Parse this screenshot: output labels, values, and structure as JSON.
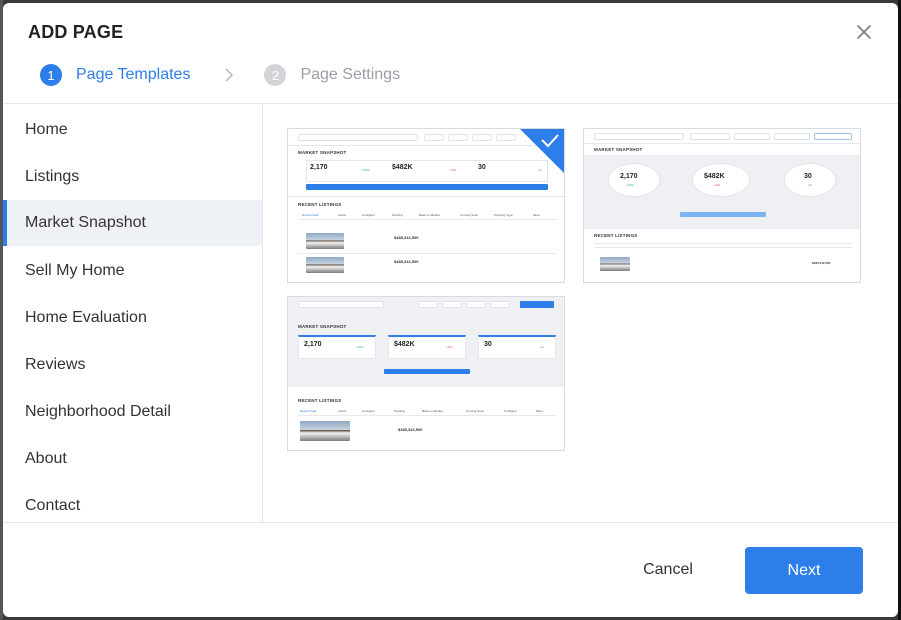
{
  "dialog": {
    "title": "ADD PAGE",
    "steps": [
      {
        "number": "1",
        "label": "Page Templates",
        "state": "active"
      },
      {
        "number": "2",
        "label": "Page Settings",
        "state": "inactive"
      }
    ]
  },
  "sidebar": {
    "items": [
      {
        "label": "Home",
        "selected": false
      },
      {
        "label": "Listings",
        "selected": false
      },
      {
        "label": "Market Snapshot",
        "selected": true
      },
      {
        "label": "Sell My Home",
        "selected": false
      },
      {
        "label": "Home Evaluation",
        "selected": false
      },
      {
        "label": "Reviews",
        "selected": false
      },
      {
        "label": "Neighborhood Detail",
        "selected": false
      },
      {
        "label": "About",
        "selected": false
      },
      {
        "label": "Contact",
        "selected": false
      }
    ]
  },
  "templates": [
    {
      "selected": true,
      "section_title": "MARKET SNAPSHOT",
      "stats": [
        {
          "value": "2,170",
          "change": "+33%",
          "trend": "up"
        },
        {
          "value": "$482K",
          "change": "+4%",
          "trend": "down"
        },
        {
          "value": "30",
          "change": "+3",
          "trend": "down"
        }
      ],
      "listings_title": "RECENT LISTINGS",
      "tabs": [
        "Recent Sold",
        "Active",
        "Contigent",
        "Pending",
        "Back on Market",
        "Coming Soon",
        "Property Type",
        "More"
      ],
      "listings": [
        {
          "price": "$485,342,500"
        },
        {
          "price": "$485,342,500"
        }
      ]
    },
    {
      "selected": false,
      "section_title": "MARKET SNAPSHOT",
      "stats": [
        {
          "value": "2,170",
          "change": "+33%",
          "trend": "up"
        },
        {
          "value": "$482K",
          "change": "+4%",
          "trend": "down"
        },
        {
          "value": "30",
          "change": "+3",
          "trend": "down"
        }
      ],
      "listings_title": "RECENT LISTINGS",
      "listings": [
        {
          "price": "$485,342,500"
        }
      ]
    },
    {
      "selected": false,
      "section_title": "MARKET SNAPSHOT",
      "stats": [
        {
          "value": "2,170",
          "change": "+33%",
          "trend": "up"
        },
        {
          "value": "$482K",
          "change": "+4%",
          "trend": "down"
        },
        {
          "value": "30",
          "change": "+3",
          "trend": "down"
        }
      ],
      "listings_title": "RECENT LISTINGS",
      "tabs": [
        "Recent Sold",
        "Active",
        "Contigent",
        "Pending",
        "Back on Market",
        "Coming Soon",
        "Contigent",
        "More"
      ],
      "listings": [
        {
          "price": "$485,342,500"
        }
      ]
    }
  ],
  "footer": {
    "cancel_label": "Cancel",
    "next_label": "Next"
  },
  "colors": {
    "accent": "#2d7ee8",
    "positive": "#2bb673",
    "negative": "#e0483e",
    "selected_bg": "#eef1f5"
  },
  "icons": {
    "close": "close-icon",
    "step_separator": "chevron-right-icon",
    "selected_template": "checkmark-icon"
  }
}
